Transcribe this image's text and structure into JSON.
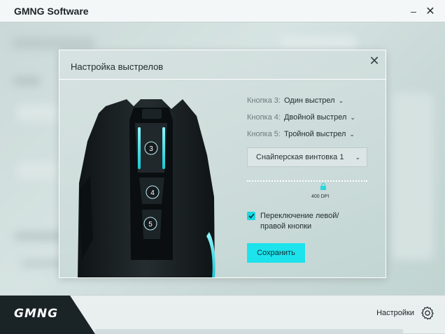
{
  "app": {
    "title": "GMNG Software",
    "minimize_glyph": "–",
    "close_glyph": "✕"
  },
  "footer": {
    "logo_text": "GMNG",
    "settings_label": "Настройки",
    "settings_icon": "gear-icon"
  },
  "modal": {
    "title": "Настройка выстрелов",
    "close_glyph": "✕",
    "buttons": [
      {
        "key": "Кнопка 3:",
        "value": "Один выстрел"
      },
      {
        "key": "Кнопка 4:",
        "value": "Двойной выстрел"
      },
      {
        "key": "Кнопка 5:",
        "value": "Тройной выстрел"
      }
    ],
    "mouse_button_badges": [
      "3",
      "4",
      "5"
    ],
    "profile_select": {
      "selected": "Снайперская винтовка 1"
    },
    "dpi_value": "400 DPI",
    "checkbox": {
      "checked": true,
      "label": "Переключение левой/ правой кнопки"
    },
    "save_label": "Сохранить"
  },
  "colors": {
    "accent": "#1de3ec",
    "mouse_body": "#161c1e",
    "glow": "#29e6f0"
  }
}
